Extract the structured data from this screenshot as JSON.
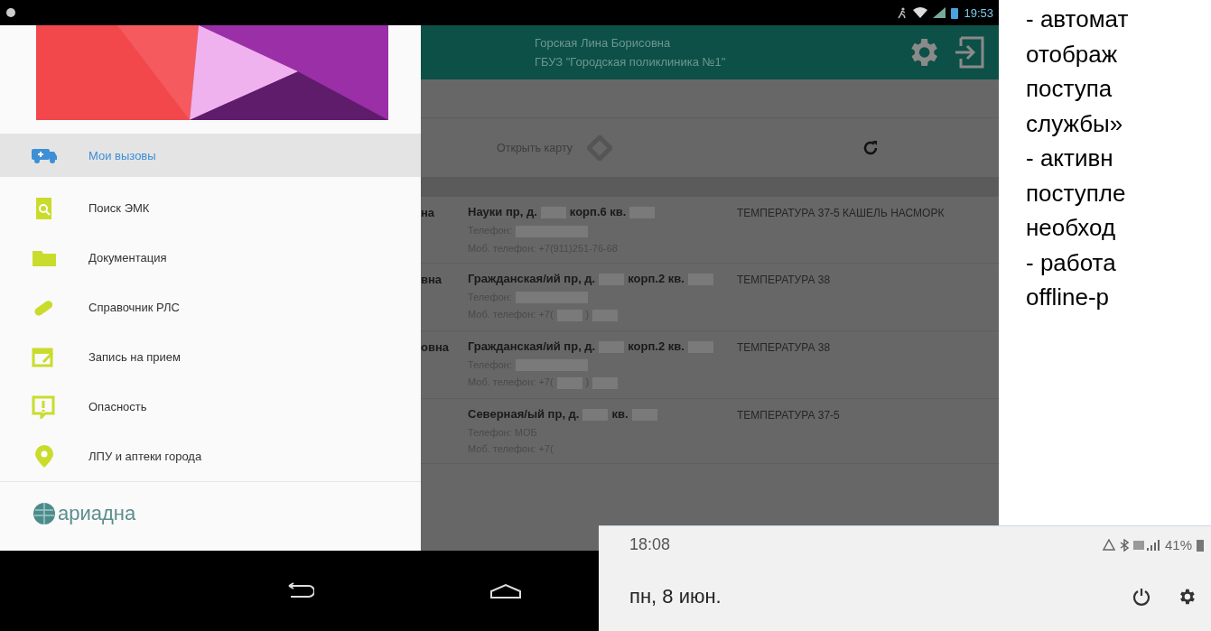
{
  "tablet": {
    "status_bar": {
      "time": "19:53"
    },
    "drawer": {
      "items": [
        {
          "label": "Мои вызовы",
          "kind": "ambulance",
          "selected": true
        },
        {
          "label": "Поиск ЭМК",
          "kind": "search",
          "selected": false
        },
        {
          "label": "Документация",
          "kind": "folder",
          "selected": false
        },
        {
          "label": "Справочник РЛС",
          "kind": "pill",
          "selected": false
        },
        {
          "label": "Запись на прием",
          "kind": "calendar",
          "selected": false
        },
        {
          "label": "Опасность",
          "kind": "alert",
          "selected": false
        },
        {
          "label": "ЛПУ и аптеки города",
          "kind": "pin",
          "selected": false
        }
      ],
      "logo": "ариадна"
    },
    "header": {
      "user": "Горская Лина Борисовна",
      "org": "ГБУЗ \"Городская поликлиника №1\""
    },
    "toolbar": {
      "open_map": "Открыть карту"
    },
    "rows": [
      {
        "name": "на",
        "address": [
          {
            "text": "Науки пр, д.",
            "redacted_after": true
          },
          {
            "text": "корп.6 кв.",
            "redacted_after": true
          }
        ],
        "phone": [
          {
            "text": "Телефон:",
            "redacted_after": true
          }
        ],
        "mobile": [
          {
            "text": "Моб. телефон: +7(911)251-76-68",
            "redacted_after": false
          }
        ],
        "complaint": "ТЕМПЕРАТУРА 37-5 КАШЕЛЬ НАСМОРК"
      },
      {
        "name": "вна",
        "address": [
          {
            "text": "Гражданская/ий пр, д.",
            "redacted_after": true
          },
          {
            "text": "корп.2 кв.",
            "redacted_after": true
          }
        ],
        "phone": [
          {
            "text": "Телефон:",
            "redacted_after": true
          }
        ],
        "mobile": [
          {
            "text": "Моб. телефон: +7(",
            "redacted_after": true
          },
          {
            "text": ")",
            "redacted_after": true
          }
        ],
        "complaint": "ТЕМПЕРАТУРА 38"
      },
      {
        "name": "овна",
        "address": [
          {
            "text": "Гражданская/ий пр, д.",
            "redacted_after": true
          },
          {
            "text": "корп.2 кв.",
            "redacted_after": true
          }
        ],
        "phone": [
          {
            "text": "Телефон:",
            "redacted_after": true
          }
        ],
        "mobile": [
          {
            "text": "Моб. телефон: +7(",
            "redacted_after": true
          },
          {
            "text": ")",
            "redacted_after": true
          }
        ],
        "complaint": "ТЕМПЕРАТУРА 38"
      },
      {
        "name": "",
        "address": [
          {
            "text": "Северная/ый пр, д.",
            "redacted_after": true
          },
          {
            "text": "кв.",
            "redacted_after": true
          }
        ],
        "phone": [
          {
            "text": "Телефон: МОБ",
            "redacted_after": false
          }
        ],
        "mobile": [
          {
            "text": "Моб. телефон: +7(",
            "redacted_after": false
          }
        ],
        "complaint": "ТЕМПЕРАТУРА 37-5"
      }
    ]
  },
  "slide_text": [
    "- автомат",
    "отображ",
    "поступа",
    "службы»",
    "- активн",
    "поступле",
    "необход",
    "- работа",
    "offline-р"
  ],
  "phone": {
    "time": "18:08",
    "battery": "41%",
    "date": "пн, 8 июн."
  }
}
